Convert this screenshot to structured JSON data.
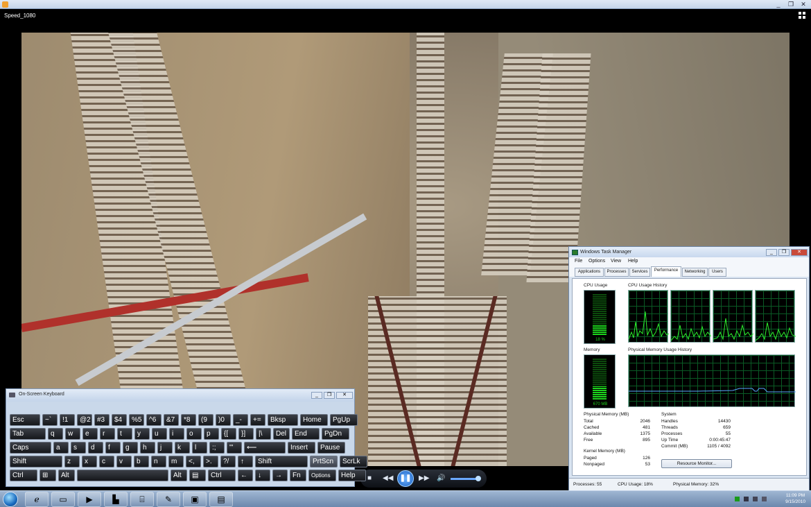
{
  "player": {
    "title": "Speed_1080"
  },
  "window_buttons": {
    "minimize": "_",
    "restore": "❐",
    "close": "✕"
  },
  "keyboard": {
    "title": "On-Screen Keyboard",
    "rows": [
      [
        "Esc",
        "~`",
        "!1",
        "@2",
        "#3",
        "$4",
        "%5",
        "^6",
        "&7",
        "*8",
        "(9",
        ")0",
        "_-",
        "+=",
        "Bksp",
        "Home",
        "PgUp"
      ],
      [
        "Tab",
        "q",
        "w",
        "e",
        "r",
        "t",
        "y",
        "u",
        "i",
        "o",
        "p",
        "{[",
        "}]",
        "|\\",
        "Del",
        "End",
        "PgDn"
      ],
      [
        "Caps",
        "a",
        "s",
        "d",
        "f",
        "g",
        "h",
        "j",
        "k",
        "l",
        ":;",
        "\"'",
        "⟵",
        "Insert",
        "Pause"
      ],
      [
        "Shift",
        "z",
        "x",
        "c",
        "v",
        "b",
        "n",
        "m",
        "<,",
        ">.",
        "?/",
        "↑",
        "Shift",
        "PrtScn",
        "ScrLk"
      ],
      [
        "Ctrl",
        "⊞",
        "Alt",
        "",
        "Alt",
        "▤",
        "Ctrl",
        "←",
        "↓",
        "→",
        "Fn",
        "Options",
        "Help"
      ]
    ]
  },
  "task_manager": {
    "title": "Windows Task Manager",
    "menu": [
      "File",
      "Options",
      "View",
      "Help"
    ],
    "tabs": [
      "Applications",
      "Processes",
      "Services",
      "Performance",
      "Networking",
      "Users"
    ],
    "active_tab": "Performance",
    "cpu_usage_label": "CPU Usage",
    "cpu_usage_value": "18 %",
    "cpu_history_label": "CPU Usage History",
    "memory_label": "Memory",
    "memory_value": "670 MB",
    "mem_history_label": "Physical Memory Usage History",
    "physical_memory": {
      "header": "Physical Memory (MB)",
      "rows": [
        [
          "Total",
          "2046"
        ],
        [
          "Cached",
          "481"
        ],
        [
          "Available",
          "1375"
        ],
        [
          "Free",
          "895"
        ]
      ]
    },
    "kernel_memory": {
      "header": "Kernel Memory (MB)",
      "rows": [
        [
          "Paged",
          "126"
        ],
        [
          "Nonpaged",
          "53"
        ]
      ]
    },
    "system": {
      "header": "System",
      "rows": [
        [
          "Handles",
          "14430"
        ],
        [
          "Threads",
          "659"
        ],
        [
          "Processes",
          "55"
        ],
        [
          "Up Time",
          "0:00:45:47"
        ],
        [
          "Commit (MB)",
          "1105 / 4092"
        ]
      ]
    },
    "resource_monitor_label": "Resource Monitor...",
    "status": {
      "processes": "Processes: 55",
      "cpu": "CPU Usage: 18%",
      "memory": "Physical Memory: 32%"
    },
    "cpu_percent": 18,
    "memory_percent": 32
  },
  "taskbar": {
    "buttons": [
      "ie-icon",
      "explorer-icon",
      "media-player-icon",
      "paint-icon",
      "network-icon",
      "paint-app-icon",
      "remote-desktop-icon",
      "task-manager-icon"
    ],
    "time": "11:09 PM",
    "date": "9/15/2010"
  }
}
